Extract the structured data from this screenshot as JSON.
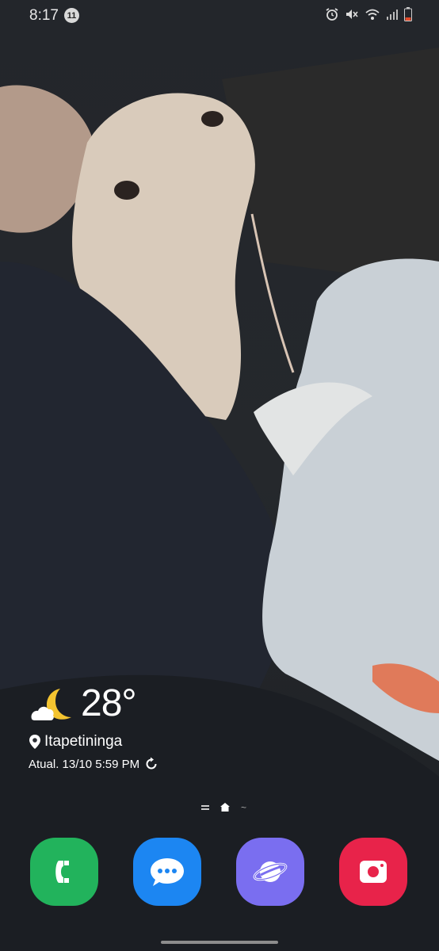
{
  "status_bar": {
    "time": "8:17",
    "notification_count": "11",
    "icons": [
      "alarm-icon",
      "mute-icon",
      "wifi-icon",
      "signal-icon",
      "battery-icon"
    ]
  },
  "weather": {
    "icon": "moon-cloud-icon",
    "temperature": "28°",
    "location": "Itapetininga",
    "updated": "Atual. 13/10 5:59 PM"
  },
  "page_indicator": [
    "pages-icon",
    "home-icon",
    "tilde-icon"
  ],
  "dock": [
    {
      "name": "Phone",
      "icon": "phone-icon",
      "color": "#22b35c"
    },
    {
      "name": "Messages",
      "icon": "messages-icon",
      "color": "#1c86f2"
    },
    {
      "name": "Internet",
      "icon": "internet-icon",
      "color": "#7a6ef0"
    },
    {
      "name": "Recorder",
      "icon": "recorder-icon",
      "color": "#e8234a"
    }
  ],
  "colors": {
    "background": "#1c1f24",
    "wallpaper_dog": "#d9cbbb",
    "wallpaper_jeans": "#c9d0d6"
  }
}
